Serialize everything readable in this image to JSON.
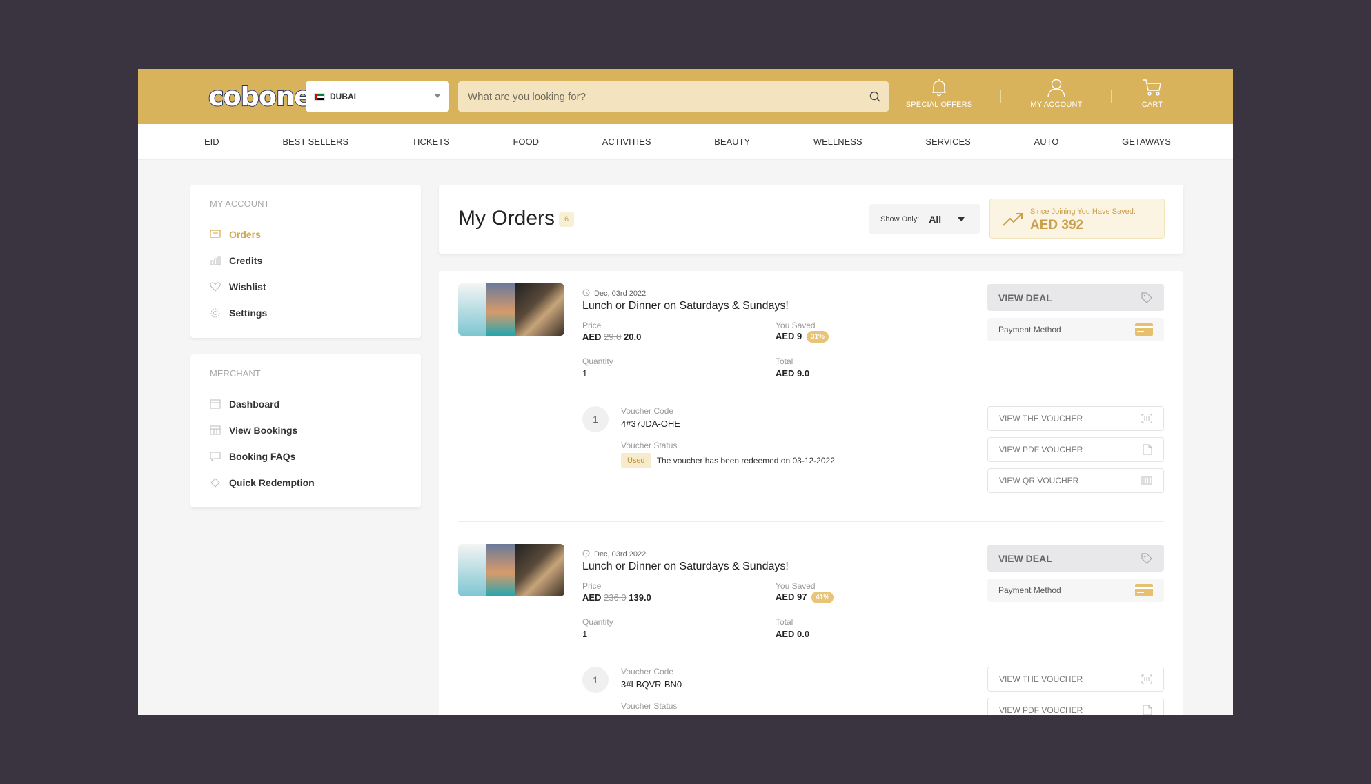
{
  "header": {
    "logo": "cobone",
    "logo_tm": "™",
    "city": "DUBAI",
    "search_placeholder": "What are you looking for?",
    "special_offers": "SPECIAL OFFERS",
    "my_account": "MY ACCOUNT",
    "cart": "CART"
  },
  "nav": [
    "EID",
    "BEST SELLERS",
    "TICKETS",
    "FOOD",
    "ACTIVITIES",
    "BEAUTY",
    "WELLNESS",
    "SERVICES",
    "AUTO",
    "GETAWAYS"
  ],
  "sidebar": {
    "account_title": "MY ACCOUNT",
    "account_items": [
      {
        "label": "Orders",
        "icon": "orders-icon"
      },
      {
        "label": "Credits",
        "icon": "credits-icon"
      },
      {
        "label": "Wishlist",
        "icon": "heart-icon"
      },
      {
        "label": "Settings",
        "icon": "gear-icon"
      }
    ],
    "merchant_title": "MERCHANT",
    "merchant_items": [
      {
        "label": "Dashboard",
        "icon": "dashboard-icon"
      },
      {
        "label": "View Bookings",
        "icon": "calendar-icon"
      },
      {
        "label": "Booking FAQs",
        "icon": "chat-icon"
      },
      {
        "label": "Quick Redemption",
        "icon": "redeem-icon"
      }
    ]
  },
  "main": {
    "title": "My Orders",
    "count": "6",
    "show_only_label": "Show Only:",
    "show_only_value": "All",
    "saved_label": "Since Joining You Have Saved:",
    "saved_value": "AED 392"
  },
  "labels": {
    "price": "Price",
    "you_saved": "You Saved",
    "quantity": "Quantity",
    "total": "Total",
    "voucher_code": "Voucher Code",
    "voucher_status": "Voucher Status",
    "view_deal": "VIEW DEAL",
    "payment_method": "Payment Method",
    "view_the_voucher": "VIEW THE VOUCHER",
    "view_pdf_voucher": "VIEW PDF VOUCHER",
    "view_qr_voucher": "VIEW QR VOUCHER",
    "aed": "AED"
  },
  "orders": [
    {
      "date": "Dec, 03rd 2022",
      "title": "Lunch or Dinner on Saturdays & Sundays!",
      "price_old": "29.0",
      "price_new": "20.0",
      "saved": "AED 9",
      "saved_pct": "31%",
      "quantity": "1",
      "total": "AED 9.0",
      "voucher_index": "1",
      "voucher_code": "4#37JDA-OHE",
      "status_badge": "Used",
      "status_text": "The voucher has been redeemed on 03-12-2022"
    },
    {
      "date": "Dec, 03rd 2022",
      "title": "Lunch or Dinner on Saturdays & Sundays!",
      "price_old": "236.0",
      "price_new": "139.0",
      "saved": "AED 97",
      "saved_pct": "41%",
      "quantity": "1",
      "total": "AED 0.0",
      "voucher_index": "1",
      "voucher_code": "3#LBQVR-BN0"
    }
  ],
  "colors": {
    "brand_gold": "#d9b35c",
    "accent_text": "#d1a650",
    "background": "#3a3440"
  }
}
